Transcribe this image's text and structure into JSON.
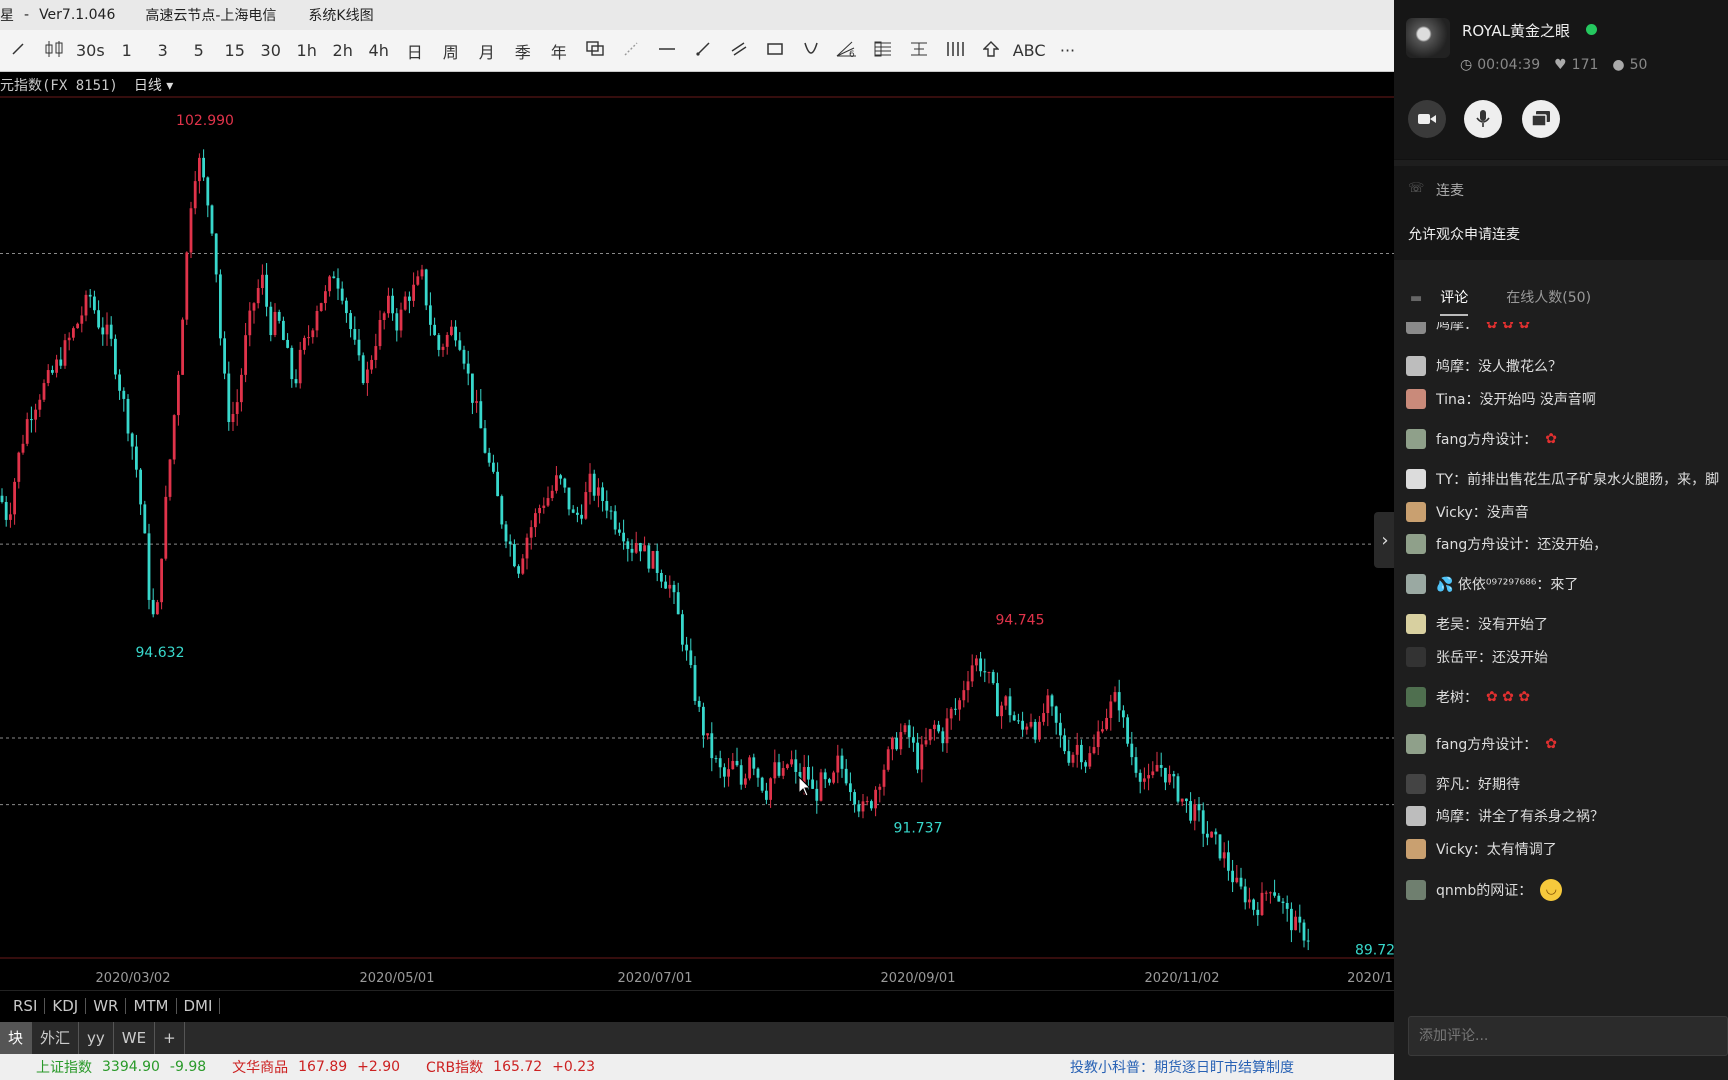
{
  "titlebar": {
    "app_name": "星",
    "separator": "-",
    "version": "Ver7.1.046",
    "server": "高速云节点-上海电信",
    "chart_mode": "系统K线图"
  },
  "toolbar": {
    "tools": [
      {
        "name": "cursor-tool",
        "label": "",
        "icon": "cursor-icon"
      },
      {
        "name": "split-tool",
        "label": "",
        "icon": "split-icon"
      },
      {
        "name": "period-30s",
        "label": "30s"
      },
      {
        "name": "period-1",
        "label": "1"
      },
      {
        "name": "period-3",
        "label": "3"
      },
      {
        "name": "period-5",
        "label": "5"
      },
      {
        "name": "period-15",
        "label": "15"
      },
      {
        "name": "period-30",
        "label": "30"
      },
      {
        "name": "period-1h",
        "label": "1h"
      },
      {
        "name": "period-2h",
        "label": "2h"
      },
      {
        "name": "period-4h",
        "label": "4h"
      },
      {
        "name": "period-day",
        "label": "日"
      },
      {
        "name": "period-week",
        "label": "周"
      },
      {
        "name": "period-month",
        "label": "月"
      },
      {
        "name": "period-season",
        "label": "季"
      },
      {
        "name": "period-year",
        "label": "年"
      },
      {
        "name": "overlay-tool",
        "label": "",
        "icon": "overlay-icon"
      },
      {
        "name": "segment-tool",
        "label": "",
        "icon": "segment-icon"
      },
      {
        "name": "hline-tool",
        "label": "",
        "icon": "horizontal-line-icon"
      },
      {
        "name": "ray-tool",
        "label": "",
        "icon": "ray-icon"
      },
      {
        "name": "channel-tool",
        "label": "",
        "icon": "parallel-channel-icon"
      },
      {
        "name": "rect-tool",
        "label": "",
        "icon": "rectangle-icon"
      },
      {
        "name": "arc-tool",
        "label": "",
        "icon": "arc-icon"
      },
      {
        "name": "fib-tool",
        "label": "",
        "icon": "fib-fan-icon"
      },
      {
        "name": "fib-retrace-tool",
        "label": "",
        "icon": "fib-retrace-icon"
      },
      {
        "name": "gann-tool",
        "label": "",
        "icon": "gann-icon"
      },
      {
        "name": "cycle-tool",
        "label": "",
        "icon": "cycle-lines-icon"
      },
      {
        "name": "arrow-tool",
        "label": "",
        "icon": "up-arrow-icon"
      },
      {
        "name": "text-tool",
        "label": "ABC"
      },
      {
        "name": "more-tool",
        "label": "···"
      }
    ]
  },
  "chart_header": {
    "symbol": "元指数(FX 8151)",
    "period": "日线"
  },
  "chart_data": {
    "type": "candlestick",
    "instrument": "元指数(FX 8151)",
    "period": "日线",
    "x_tick_labels": [
      "2020/03/02",
      "2020/05/01",
      "2020/07/01",
      "2020/09/01",
      "2020/11/02",
      "2020/1"
    ],
    "ylim": [
      89.4,
      103.6
    ],
    "reference_lines": [
      101.0,
      96.2,
      93.0,
      91.9
    ],
    "annotations": [
      {
        "label": "102.990",
        "value": 102.99,
        "kind": "high"
      },
      {
        "label": "94.632",
        "value": 94.632,
        "kind": "low"
      },
      {
        "label": "94.745",
        "value": 94.745,
        "kind": "high"
      },
      {
        "label": "91.737",
        "value": 91.737,
        "kind": "low"
      },
      {
        "label": "89.72",
        "value": 89.72,
        "kind": "low"
      }
    ],
    "close_path": [
      [
        0,
        97.0
      ],
      [
        8,
        96.6
      ],
      [
        18,
        97.6
      ],
      [
        28,
        98.3
      ],
      [
        40,
        98.7
      ],
      [
        52,
        99.0
      ],
      [
        64,
        99.4
      ],
      [
        76,
        99.8
      ],
      [
        90,
        100.3
      ],
      [
        100,
        99.8
      ],
      [
        110,
        99.6
      ],
      [
        120,
        98.8
      ],
      [
        128,
        98.2
      ],
      [
        136,
        97.5
      ],
      [
        144,
        96.4
      ],
      [
        150,
        95.2
      ],
      [
        156,
        94.8
      ],
      [
        162,
        96.2
      ],
      [
        170,
        97.6
      ],
      [
        178,
        99.0
      ],
      [
        186,
        100.8
      ],
      [
        192,
        102.1
      ],
      [
        198,
        102.6
      ],
      [
        206,
        102.0
      ],
      [
        214,
        101.3
      ],
      [
        222,
        99.2
      ],
      [
        230,
        98.2
      ],
      [
        238,
        98.6
      ],
      [
        246,
        99.6
      ],
      [
        254,
        100.2
      ],
      [
        262,
        100.6
      ],
      [
        270,
        99.8
      ],
      [
        278,
        99.9
      ],
      [
        286,
        99.4
      ],
      [
        294,
        98.8
      ],
      [
        302,
        99.4
      ],
      [
        310,
        99.7
      ],
      [
        318,
        100.2
      ],
      [
        326,
        100.3
      ],
      [
        334,
        100.7
      ],
      [
        342,
        100.4
      ],
      [
        350,
        99.8
      ],
      [
        358,
        99.2
      ],
      [
        366,
        98.9
      ],
      [
        374,
        99.5
      ],
      [
        382,
        99.9
      ],
      [
        390,
        100.2
      ],
      [
        398,
        99.8
      ],
      [
        406,
        100.3
      ],
      [
        414,
        100.4
      ],
      [
        422,
        100.6
      ],
      [
        430,
        99.9
      ],
      [
        438,
        99.4
      ],
      [
        446,
        99.6
      ],
      [
        454,
        99.8
      ],
      [
        462,
        99.5
      ],
      [
        470,
        98.8
      ],
      [
        478,
        98.3
      ],
      [
        486,
        97.7
      ],
      [
        494,
        97.2
      ],
      [
        502,
        96.6
      ],
      [
        510,
        96.2
      ],
      [
        518,
        95.8
      ],
      [
        526,
        96.3
      ],
      [
        534,
        96.6
      ],
      [
        542,
        96.9
      ],
      [
        550,
        97.0
      ],
      [
        558,
        97.3
      ],
      [
        566,
        97.0
      ],
      [
        574,
        96.6
      ],
      [
        582,
        96.8
      ],
      [
        590,
        97.2
      ],
      [
        598,
        97.0
      ],
      [
        606,
        96.9
      ],
      [
        614,
        96.6
      ],
      [
        622,
        96.5
      ],
      [
        630,
        96.1
      ],
      [
        638,
        96.3
      ],
      [
        646,
        96.0
      ],
      [
        654,
        95.9
      ],
      [
        662,
        95.7
      ],
      [
        670,
        95.5
      ],
      [
        678,
        95.0
      ],
      [
        686,
        94.4
      ],
      [
        694,
        93.8
      ],
      [
        702,
        93.2
      ],
      [
        710,
        92.8
      ],
      [
        718,
        92.5
      ],
      [
        726,
        92.3
      ],
      [
        734,
        92.6
      ],
      [
        742,
        92.2
      ],
      [
        750,
        92.8
      ],
      [
        758,
        92.4
      ],
      [
        766,
        92.1
      ],
      [
        774,
        92.5
      ],
      [
        782,
        92.3
      ],
      [
        790,
        92.7
      ],
      [
        798,
        92.2
      ],
      [
        806,
        92.5
      ],
      [
        814,
        92.0
      ],
      [
        822,
        92.3
      ],
      [
        830,
        92.1
      ],
      [
        838,
        92.6
      ],
      [
        846,
        92.4
      ],
      [
        854,
        92.1
      ],
      [
        862,
        91.8
      ],
      [
        870,
        91.9
      ],
      [
        878,
        92.3
      ],
      [
        886,
        92.6
      ],
      [
        894,
        92.9
      ],
      [
        902,
        93.1
      ],
      [
        910,
        93.0
      ],
      [
        918,
        92.6
      ],
      [
        926,
        92.9
      ],
      [
        934,
        93.2
      ],
      [
        942,
        93.0
      ],
      [
        950,
        93.4
      ],
      [
        958,
        93.5
      ],
      [
        966,
        94.0
      ],
      [
        974,
        94.3
      ],
      [
        982,
        94.2
      ],
      [
        990,
        93.9
      ],
      [
        998,
        93.5
      ],
      [
        1006,
        93.6
      ],
      [
        1014,
        93.3
      ],
      [
        1022,
        93.1
      ],
      [
        1030,
        93.4
      ],
      [
        1038,
        93.0
      ],
      [
        1046,
        93.6
      ],
      [
        1054,
        93.3
      ],
      [
        1062,
        92.9
      ],
      [
        1070,
        92.7
      ],
      [
        1078,
        92.9
      ],
      [
        1086,
        92.6
      ],
      [
        1094,
        92.8
      ],
      [
        1102,
        93.3
      ],
      [
        1110,
        93.5
      ],
      [
        1118,
        93.7
      ],
      [
        1126,
        93.0
      ],
      [
        1134,
        92.6
      ],
      [
        1142,
        92.4
      ],
      [
        1150,
        92.2
      ],
      [
        1158,
        92.6
      ],
      [
        1166,
        92.4
      ],
      [
        1174,
        92.2
      ],
      [
        1182,
        92.0
      ],
      [
        1190,
        91.8
      ],
      [
        1198,
        91.7
      ],
      [
        1206,
        91.4
      ],
      [
        1214,
        91.3
      ],
      [
        1222,
        91.1
      ],
      [
        1230,
        90.8
      ],
      [
        1238,
        90.5
      ],
      [
        1246,
        90.4
      ],
      [
        1254,
        90.2
      ],
      [
        1262,
        90.3
      ],
      [
        1270,
        90.6
      ],
      [
        1278,
        90.4
      ],
      [
        1286,
        90.1
      ],
      [
        1294,
        89.9
      ],
      [
        1302,
        89.8
      ],
      [
        1310,
        89.72
      ]
    ]
  },
  "indicators": [
    "RSI",
    "KDJ",
    "WR",
    "MTM",
    "DMI"
  ],
  "market_tabs": [
    "块",
    "外汇",
    "yy",
    "WE",
    "+"
  ],
  "statusbar": {
    "items": [
      {
        "label": "上证指数",
        "value": "3394.90",
        "change": "-9.98",
        "label_color": "#2a9a2a",
        "value_color": "#2a9a2a"
      },
      {
        "label": "文华商品",
        "value": "167.89",
        "change": "+2.90",
        "label_color": "#cc2222",
        "value_color": "#cc2222"
      },
      {
        "label": "CRB指数",
        "value": "165.72",
        "change": "+0.23",
        "label_color": "#cc2222",
        "value_color": "#cc2222"
      }
    ],
    "notice": "投教小科普：期货逐日盯市结算制度"
  },
  "live": {
    "host_name": "ROYAL黄金之眼",
    "status_color": "#25c85f",
    "duration": "00:04:39",
    "likes": "171",
    "viewers": "50",
    "lianmai_title": "连麦",
    "lianmai_allow": "允许观众申请连麦",
    "tab_comments": "评论",
    "tab_online": "在线人数(50)",
    "input_placeholder": "添加评论...",
    "comments": [
      {
        "text": "鸠摩：",
        "tail": "🌹 🌹 🌹",
        "y": 0,
        "avatar": "#8a8a8a"
      },
      {
        "text": "鸠摩：没人撒花么？",
        "y": 34,
        "avatar": "#bdbdbd"
      },
      {
        "text": "Tina：没开始吗 没声音啊",
        "y": 67,
        "avatar": "#c98a7a"
      },
      {
        "text": "fang方舟设计：",
        "tail": "🌹",
        "y": 107,
        "avatar": "#8fa08a"
      },
      {
        "text": "TY：前排出售花生瓜子矿泉水火腿肠，来，脚",
        "y": 147,
        "avatar": "#dcdcdc"
      },
      {
        "text": "Vicky：没声音",
        "y": 180,
        "avatar": "#c9a070"
      },
      {
        "text": "fang方舟设计：还没开始，",
        "y": 212,
        "avatar": "#8fa08a"
      },
      {
        "text": "💦 依依⁰⁹⁷²⁹⁷⁶⁸⁶：來了",
        "y": 252,
        "avatar": "#9aa9a2"
      },
      {
        "text": "老吴：没有开始了",
        "y": 292,
        "avatar": "#d8d0a0"
      },
      {
        "text": "张岳平：还没开始",
        "y": 325,
        "avatar": "#333333"
      },
      {
        "text": "老树：",
        "tail": "🌹 🌹 🌹",
        "y": 365,
        "avatar": "#4f6f4f"
      },
      {
        "text": "fang方舟设计：",
        "tail": "🌹",
        "y": 412,
        "avatar": "#8fa08a"
      },
      {
        "text": "弈凡：好期待",
        "y": 452,
        "avatar": "#444444"
      },
      {
        "text": "鸠摩：讲全了有杀身之祸？",
        "y": 484,
        "avatar": "#bdbdbd"
      },
      {
        "text": "Vicky：太有情调了",
        "y": 517,
        "avatar": "#c9a070"
      },
      {
        "text": "qnmb的网证：",
        "tail": "😊",
        "y": 557,
        "avatar": "#6f7f6f"
      }
    ]
  }
}
